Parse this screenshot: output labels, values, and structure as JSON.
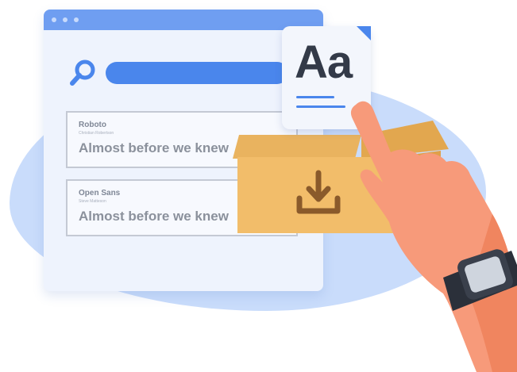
{
  "window": {
    "font_cards": [
      {
        "name": "Roboto",
        "author": "Christian Robertson",
        "sample": "Almost before we knew"
      },
      {
        "name": "Open Sans",
        "author": "Steve Matteson",
        "sample": "Almost before we knew"
      }
    ]
  },
  "paper": {
    "glyph": "Aa"
  },
  "icons": [
    "search-icon",
    "download-icon",
    "wristwatch-icon"
  ],
  "colors": {
    "accent": "#4a86ec",
    "background_blob": "#c9dcfb",
    "box": "#f2bd6a",
    "skin": "#f79a7a"
  }
}
